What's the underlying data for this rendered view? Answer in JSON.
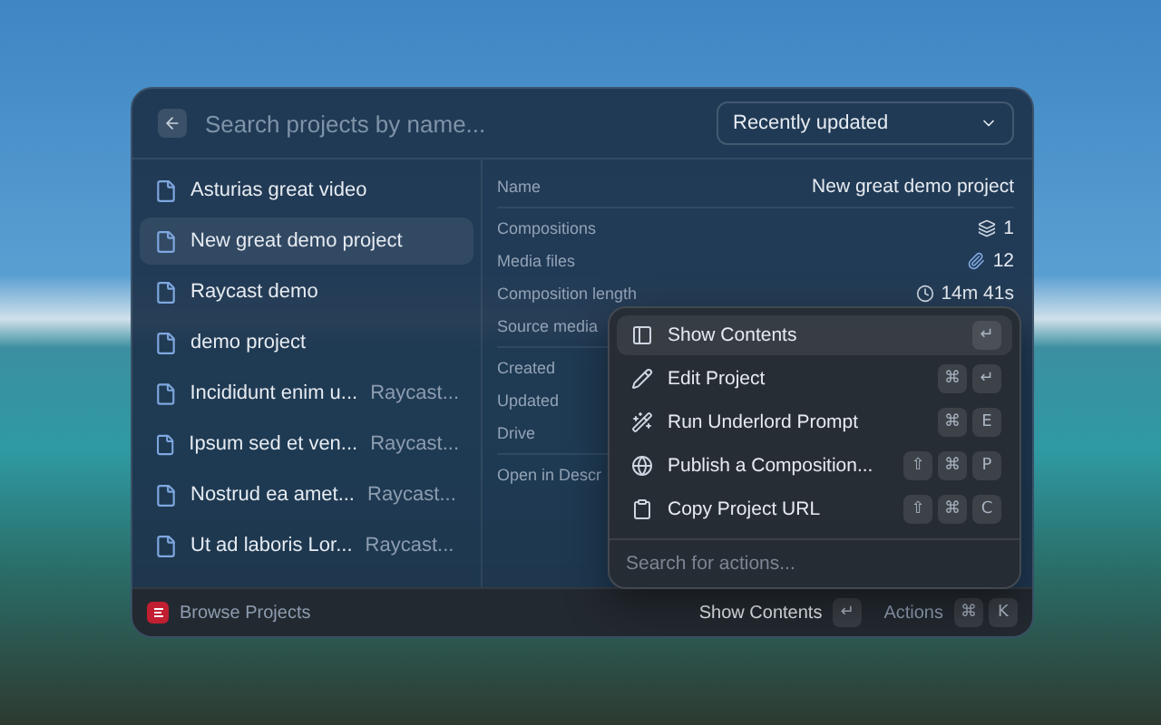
{
  "search": {
    "placeholder": "Search projects by name..."
  },
  "sort": {
    "value": "Recently updated"
  },
  "projects": [
    {
      "title": "Asturias great video",
      "selected": false
    },
    {
      "title": "New great demo project",
      "selected": true
    },
    {
      "title": "Raycast demo",
      "selected": false
    },
    {
      "title": "demo project",
      "selected": false
    },
    {
      "title": "Incididunt enim u...",
      "subtitle": "Raycast...",
      "selected": false
    },
    {
      "title": "Ipsum sed et ven...",
      "subtitle": "Raycast...",
      "selected": false
    },
    {
      "title": "Nostrud ea amet...",
      "subtitle": "Raycast...",
      "selected": false
    },
    {
      "title": "Ut ad laboris Lor...",
      "subtitle": "Raycast...",
      "selected": false
    }
  ],
  "details": {
    "groups": [
      [
        {
          "label": "Name",
          "value": "New great demo project"
        }
      ],
      [
        {
          "label": "Compositions",
          "value": "1"
        },
        {
          "label": "Media files",
          "value": "12"
        },
        {
          "label": "Composition length",
          "value": "14m 41s"
        },
        {
          "label": "Source media"
        }
      ],
      [
        {
          "label": "Created"
        },
        {
          "label": "Updated"
        },
        {
          "label": "Drive"
        }
      ],
      [
        {
          "label": "Open in Descr"
        }
      ]
    ]
  },
  "actions": {
    "items": [
      {
        "label": "Show Contents",
        "keys": [
          "↵"
        ],
        "selected": true
      },
      {
        "label": "Edit Project",
        "keys": [
          "⌘",
          "↵"
        ],
        "selected": false
      },
      {
        "label": "Run Underlord Prompt",
        "keys": [
          "⌘",
          "E"
        ],
        "selected": false
      },
      {
        "label": "Publish a Composition...",
        "keys": [
          "⇧",
          "⌘",
          "P"
        ],
        "selected": false
      },
      {
        "label": "Copy Project URL",
        "keys": [
          "⇧",
          "⌘",
          "C"
        ],
        "selected": false
      }
    ],
    "search_placeholder": "Search for actions..."
  },
  "footer": {
    "title": "Browse Projects",
    "primary_action": "Show Contents",
    "primary_keys": [
      "↵"
    ],
    "actions_label": "Actions",
    "actions_keys": [
      "⌘",
      "K"
    ]
  }
}
